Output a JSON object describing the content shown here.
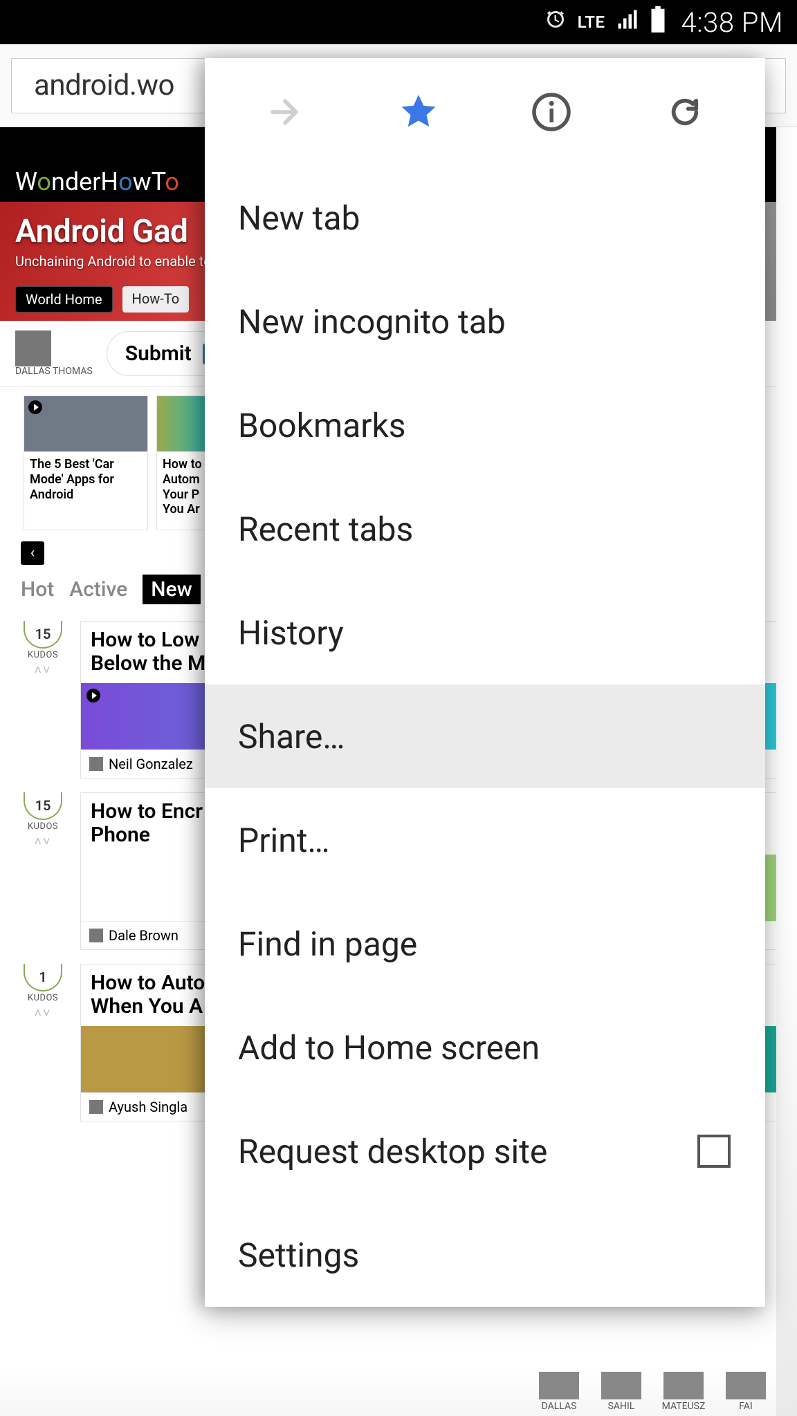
{
  "status_bar": {
    "alarm": true,
    "network_label": "LTE",
    "signal_bars": 4,
    "battery_pct": 95,
    "time": "4:38 PM"
  },
  "browser": {
    "url_text": "android.wo"
  },
  "site": {
    "logo_text": "WonderHowTo",
    "hero_title": "Android Gad",
    "hero_tag": "Unchaining Android to enable to",
    "hero_tabs": [
      "World Home",
      "How-To"
    ]
  },
  "submit": {
    "author_name": "DALLAS THOMAS",
    "button_label": "Submit"
  },
  "cards": [
    {
      "title": "The 5 Best 'Car Mode' Apps for Android"
    },
    {
      "title": "How to\nAutom\nYour P\nYou Ar"
    }
  ],
  "tabs": {
    "items": [
      "Hot",
      "Active",
      "New"
    ],
    "active_index": 2
  },
  "feed": [
    {
      "kudos": 15,
      "kudos_label": "KUDOS",
      "title": "How to Low\nBelow the M",
      "author": "Neil Gonzalez"
    },
    {
      "kudos": 15,
      "kudos_label": "KUDOS",
      "title": "How to Encr\nPhone",
      "author": "Dale Brown"
    },
    {
      "kudos": 1,
      "kudos_label": "KUDOS",
      "title": "How to Auto\nWhen You A",
      "author": "Ayush Singla"
    }
  ],
  "menu": {
    "icons": [
      "forward",
      "bookmark-star",
      "info",
      "refresh"
    ],
    "items": [
      {
        "label": "New tab"
      },
      {
        "label": "New incognito tab"
      },
      {
        "label": "Bookmarks"
      },
      {
        "label": "Recent tabs"
      },
      {
        "label": "History"
      },
      {
        "label": "Share…",
        "highlight": true
      },
      {
        "label": "Print…"
      },
      {
        "label": "Find in page"
      },
      {
        "label": "Add to Home screen"
      },
      {
        "label": "Request desktop site",
        "checkbox": true,
        "checked": false
      },
      {
        "label": "Settings"
      }
    ]
  },
  "footer_users": [
    "DALLAS",
    "SAHIL",
    "MATEUSZ",
    "FAI"
  ]
}
